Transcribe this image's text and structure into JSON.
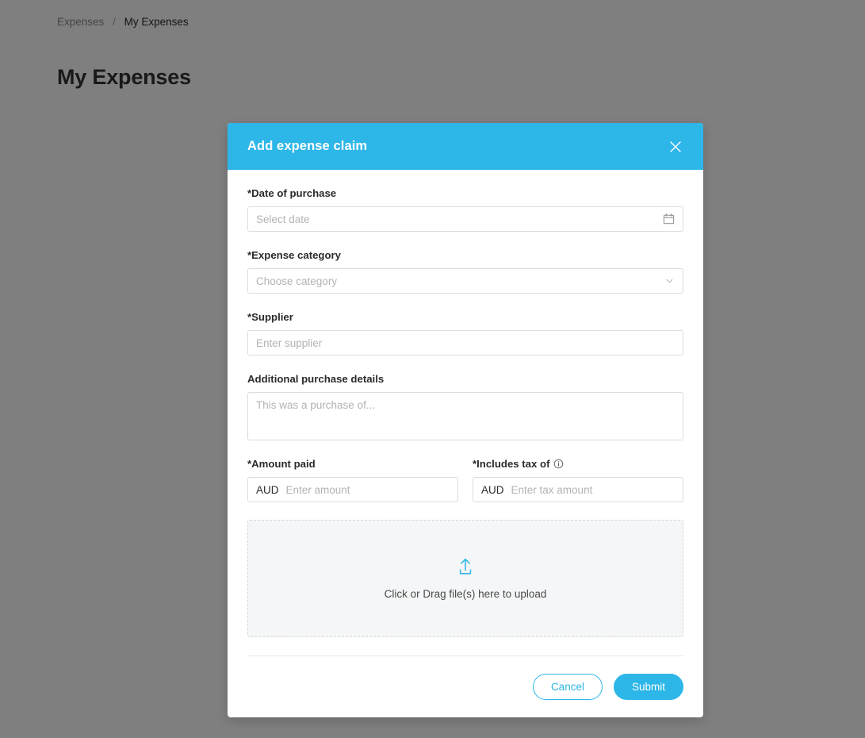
{
  "page": {
    "breadcrumb": {
      "parent": "Expenses",
      "separator": "/",
      "current": "My Expenses"
    },
    "title": "My Expenses"
  },
  "modal": {
    "title": "Add expense claim",
    "close_icon": "close-icon",
    "fields": {
      "date": {
        "label": "*Date of purchase",
        "placeholder": "Select date",
        "value": "",
        "icon": "calendar-icon"
      },
      "category": {
        "label": "*Expense category",
        "placeholder": "Choose category",
        "value": "",
        "icon": "chevron-down-icon"
      },
      "supplier": {
        "label": "*Supplier",
        "placeholder": "Enter supplier",
        "value": ""
      },
      "details": {
        "label": "Additional purchase details",
        "placeholder": "This was a purchase of...",
        "value": ""
      },
      "amount_paid": {
        "label": "*Amount paid",
        "currency": "AUD",
        "placeholder": "Enter amount",
        "value": ""
      },
      "includes_tax": {
        "label": "*Includes tax of",
        "info_icon": "info-icon",
        "currency": "AUD",
        "placeholder": "Enter tax amount",
        "value": ""
      }
    },
    "upload": {
      "icon": "upload-icon",
      "text": "Click or Drag file(s) here to upload"
    },
    "footer": {
      "cancel_label": "Cancel",
      "submit_label": "Submit"
    }
  },
  "colors": {
    "accent": "#2DB6E8",
    "overlay": "rgba(0,0,0,0.5)",
    "text_dark": "#2b2b2b",
    "placeholder": "#b3b3b3",
    "dropzone_bg": "#f5f6f7"
  }
}
